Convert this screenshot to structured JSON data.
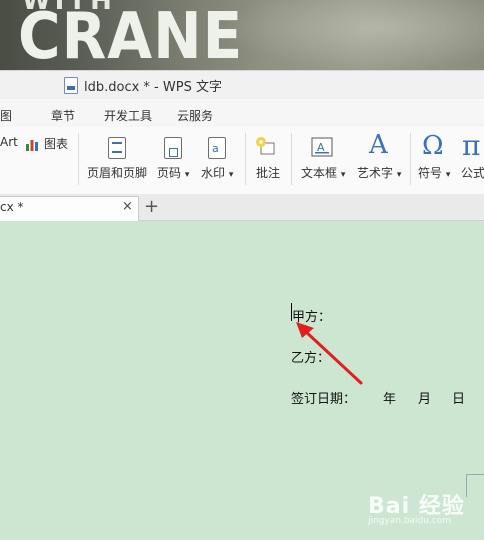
{
  "wallpaper": {
    "top_text": "WITH",
    "title": "CRANE"
  },
  "window": {
    "title": "ldb.docx * - WPS 文字"
  },
  "menu": {
    "tabs": [
      "图",
      "章节",
      "开发工具",
      "云服务"
    ]
  },
  "ribbon": {
    "art_label": "Art",
    "chart_label": "图表",
    "header_footer": "页眉和页脚",
    "page_number": "页码",
    "watermark": "水印",
    "comment": "批注",
    "textbox": "文本框",
    "wordart": "艺术字",
    "symbol": "符号",
    "formula": "公式",
    "wordart_glyph": "A",
    "symbol_glyph": "Ω",
    "formula_glyph": "π",
    "dropdown": "▾"
  },
  "tabs": {
    "doc_tab": "cx *",
    "close": "×",
    "add": "+"
  },
  "document": {
    "party_a": "甲方：",
    "party_b": "乙方：",
    "sign_date": "签订日期：",
    "year": "年",
    "month": "月",
    "day": "日"
  },
  "watermark": {
    "brand": "Bai 经验",
    "url": "jingyan.baidu.com"
  },
  "colors": {
    "doc_bg": "#cde6d2",
    "arrow": "#e02020",
    "accent": "#3a6fc1"
  }
}
